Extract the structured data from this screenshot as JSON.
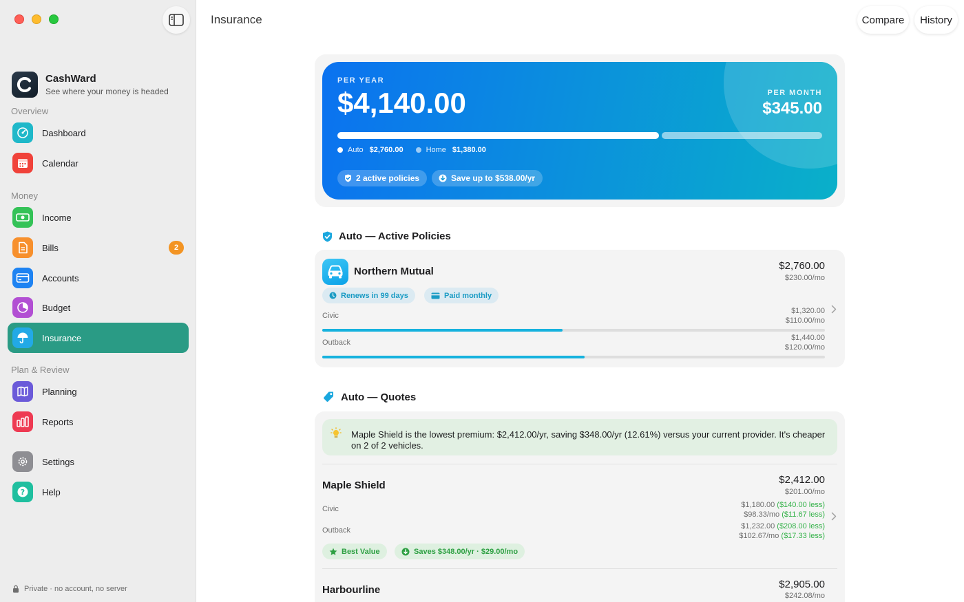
{
  "window": {
    "title": "Insurance"
  },
  "header": {
    "compare_label": "Compare",
    "history_label": "History"
  },
  "brand": {
    "name": "CashWard",
    "tagline": "See where your money is headed"
  },
  "sidebar": {
    "sections": {
      "overview": "Overview",
      "money": "Money",
      "plan_review": "Plan & Review"
    },
    "items": [
      {
        "label": "Dashboard",
        "icon": "gauge-icon",
        "color": "#1fb8c9"
      },
      {
        "label": "Calendar",
        "icon": "calendar-icon",
        "color": "#f0423a"
      },
      {
        "label": "Income",
        "icon": "banknote-icon",
        "color": "#34c257"
      },
      {
        "label": "Bills",
        "icon": "document-icon",
        "color": "#f7902d",
        "badge": "2"
      },
      {
        "label": "Accounts",
        "icon": "card-icon",
        "color": "#1e83f2"
      },
      {
        "label": "Budget",
        "icon": "pie-icon",
        "color": "#b24fd3"
      },
      {
        "label": "Insurance",
        "icon": "umbrella-icon",
        "color": "#22a9e6",
        "active": true
      },
      {
        "label": "Planning",
        "icon": "map-icon",
        "color": "#6b5ad9"
      },
      {
        "label": "Reports",
        "icon": "bar-chart-icon",
        "color": "#ee3a52"
      },
      {
        "label": "Settings",
        "icon": "gear-icon",
        "color": "#8e8e93"
      },
      {
        "label": "Help",
        "icon": "question-icon",
        "color": "#1fbf9f"
      }
    ],
    "footer": "Private · no account, no server"
  },
  "summary": {
    "per_year_label": "PER YEAR",
    "per_year": "$4,140.00",
    "per_month_label": "PER MONTH",
    "per_month": "$345.00",
    "breakdown": [
      {
        "name": "Auto",
        "amount": "$2,760.00",
        "share": 0.667
      },
      {
        "name": "Home",
        "amount": "$1,380.00",
        "share": 0.333
      }
    ],
    "pills": [
      "2 active policies",
      "Save up to $538.00/yr"
    ]
  },
  "active": {
    "title": "Auto — Active Policies",
    "provider": "Northern Mutual",
    "annual": "$2,760.00",
    "monthly": "$230.00/mo",
    "chips": [
      "Renews in 99 days",
      "Paid monthly"
    ],
    "vehicles": [
      {
        "name": "Civic",
        "annual": "$1,320.00",
        "monthly": "$110.00/mo",
        "share": 0.478
      },
      {
        "name": "Outback",
        "annual": "$1,440.00",
        "monthly": "$120.00/mo",
        "share": 0.522
      }
    ]
  },
  "quotes": {
    "title": "Auto — Quotes",
    "tip": "Maple Shield is the lowest premium: $2,412.00/yr, saving $348.00/yr (12.61%) versus your current provider. It's cheaper on 2 of 2 vehicles.",
    "items": [
      {
        "provider": "Maple Shield",
        "annual": "$2,412.00",
        "monthly": "$201.00/mo",
        "vehicles": [
          {
            "name": "Civic",
            "annual": "$1,180.00",
            "annual_less": "($140.00 less)",
            "monthly": "$98.33/mo",
            "monthly_less": "($11.67 less)"
          },
          {
            "name": "Outback",
            "annual": "$1,232.00",
            "annual_less": "($208.00 less)",
            "monthly": "$102.67/mo",
            "monthly_less": "($17.33 less)"
          }
        ],
        "chips": [
          "Best Value",
          "Saves $348.00/yr · $29.00/mo"
        ]
      },
      {
        "provider": "Harbourline",
        "annual": "$2,905.00",
        "monthly": "$242.08/mo"
      }
    ]
  }
}
